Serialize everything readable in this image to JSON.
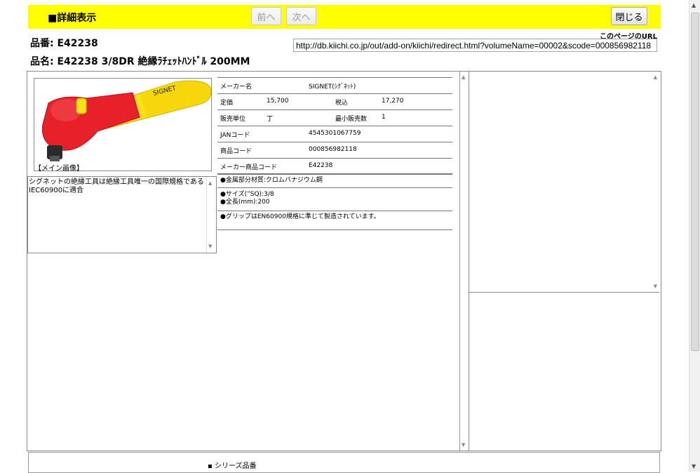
{
  "header": {
    "title": "■詳細表示",
    "prev_label": "前へ",
    "next_label": "次へ",
    "close_label": "閉じる"
  },
  "product": {
    "number_line": "品番: E42238",
    "name_line": "品名: E42238 3/8DR 絶縁ﾗﾁｪｯﾄﾊﾝﾄﾞﾙ 200MM"
  },
  "page_url": {
    "label": "このページのURL",
    "value": "http://db.kiichi.co.jp/out/add-on/kiichi/redirect.html?volumeName=00002&scode=000856982118"
  },
  "image": {
    "caption": "【メイン画像】"
  },
  "description": "シグネットの絶縁工具は絶縁工具唯一の国際規格であるIEC60900に適合",
  "specs": {
    "maker_label": "メーカー名",
    "maker_value": "SIGNET(ｼｸﾞﾈｯﾄ)",
    "list_price_label": "定価",
    "list_price_value": "15,700",
    "tax_incl_label": "税込",
    "tax_incl_value": "17,270",
    "unit_label": "販売単位",
    "unit_value": "丁",
    "min_qty_label": "最小販売数",
    "min_qty_value": "1",
    "jan_label": "JANコード",
    "jan_value": "4545301067759",
    "code_label": "商品コード",
    "code_value": "000856982118",
    "maker_code_label": "メーカー商品コード",
    "maker_code_value": "E42238"
  },
  "features": {
    "material": "●金属部分材質:クロムバナジウム鋼",
    "size": "●サイズ(”SQ):3/8",
    "length": "●全長(mm):200",
    "grip": "●グリップはEN60900規格に準じて製造されています。"
  },
  "series": {
    "label": "シリーズ品番"
  },
  "colors": {
    "header_bg": "#ffff00",
    "tool_red": "#e8202a",
    "tool_yellow": "#f7e21a"
  }
}
